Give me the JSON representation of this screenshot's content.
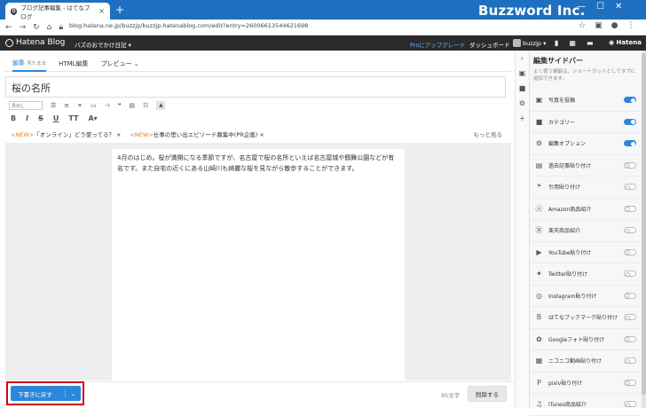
{
  "browser": {
    "tab_title": "ブログ記事編集 - はてなブログ",
    "brand": "Buzzword Inc.",
    "url": "blog.hatena.ne.jp/buzzjp/buzzjp.hatenablog.com/edit?entry=26006613544621698"
  },
  "hatena_bar": {
    "logo": "Hatena Blog",
    "blog_name": "バズのおでかけ日記 ▾",
    "pro_link": "Proにアップグレード",
    "dashboard": "ダッシュボード",
    "user": "buzzjp ▾",
    "brand_right": "◉ Hatena"
  },
  "editor": {
    "tabs": [
      {
        "label": "編集",
        "sub": "見たまま"
      },
      {
        "label": "HTML編集",
        "sub": ""
      },
      {
        "label": "プレビュー ⌄",
        "sub": ""
      }
    ],
    "title": "桜の名所",
    "format_select": "見出し",
    "news": [
      {
        "tag": "<NEW>",
        "text": "「オンライン」どう使ってる？ ×"
      },
      {
        "tag": "<NEW>",
        "text": "仕事の思い出エピソード募集中(PR企画) ×"
      }
    ],
    "news_more": "もっと見る",
    "body": "4月のはじめ。桜が満開になる季節ですが、名古屋で桜の名所といえば名古屋城や鶴舞公園などが有名です。また自宅の近くにある山崎川も綺麗な桜を見ながら散歩することができます。"
  },
  "footer": {
    "draft_button": "下書きに戻す",
    "char_count": "85文字",
    "delete_button": "削除する"
  },
  "sidebar": {
    "title": "編集サイドバー",
    "description": "よく使う機能は、ショートカットとしてタブに追加できます。",
    "items": [
      {
        "label": "写真を投稿",
        "icon": "photo-icon",
        "glyph": "▣",
        "on": true
      },
      {
        "label": "カテゴリー",
        "icon": "folder-icon",
        "glyph": "■",
        "on": true
      },
      {
        "label": "編集オプション",
        "icon": "gear-icon",
        "glyph": "⚙",
        "on": true
      },
      {
        "label": "過去記事貼り付け",
        "icon": "document-icon",
        "glyph": "▤",
        "on": false
      },
      {
        "label": "引用貼り付け",
        "icon": "quote-icon",
        "glyph": "❝",
        "on": false
      },
      {
        "label": "Amazon商品紹介",
        "icon": "amazon-icon",
        "glyph": "ⓐ",
        "on": false
      },
      {
        "label": "楽天商品紹介",
        "icon": "rakuten-icon",
        "glyph": "Ⓡ",
        "on": false
      },
      {
        "label": "YouTube貼り付け",
        "icon": "youtube-icon",
        "glyph": "▶",
        "on": false
      },
      {
        "label": "Twitter貼り付け",
        "icon": "twitter-icon",
        "glyph": "✦",
        "on": false
      },
      {
        "label": "Instagram貼り付け",
        "icon": "instagram-icon",
        "glyph": "◎",
        "on": false
      },
      {
        "label": "はてなブックマーク貼り付け",
        "icon": "hatena-bookmark-icon",
        "glyph": "B",
        "on": false
      },
      {
        "label": "Googleフォト貼り付け",
        "icon": "google-photos-icon",
        "glyph": "✿",
        "on": false
      },
      {
        "label": "ニコニコ動画貼り付け",
        "icon": "niconico-icon",
        "glyph": "▦",
        "on": false
      },
      {
        "label": "pixiv貼り付け",
        "icon": "pixiv-icon",
        "glyph": "P",
        "on": false
      },
      {
        "label": "iTunes商品紹介",
        "icon": "itunes-icon",
        "glyph": "♫",
        "on": false
      }
    ]
  },
  "colors": {
    "accent": "#2b87da",
    "chrome": "#1f6fc0",
    "hatena_bar": "#2b2b2b",
    "highlight": "#d0021b"
  }
}
